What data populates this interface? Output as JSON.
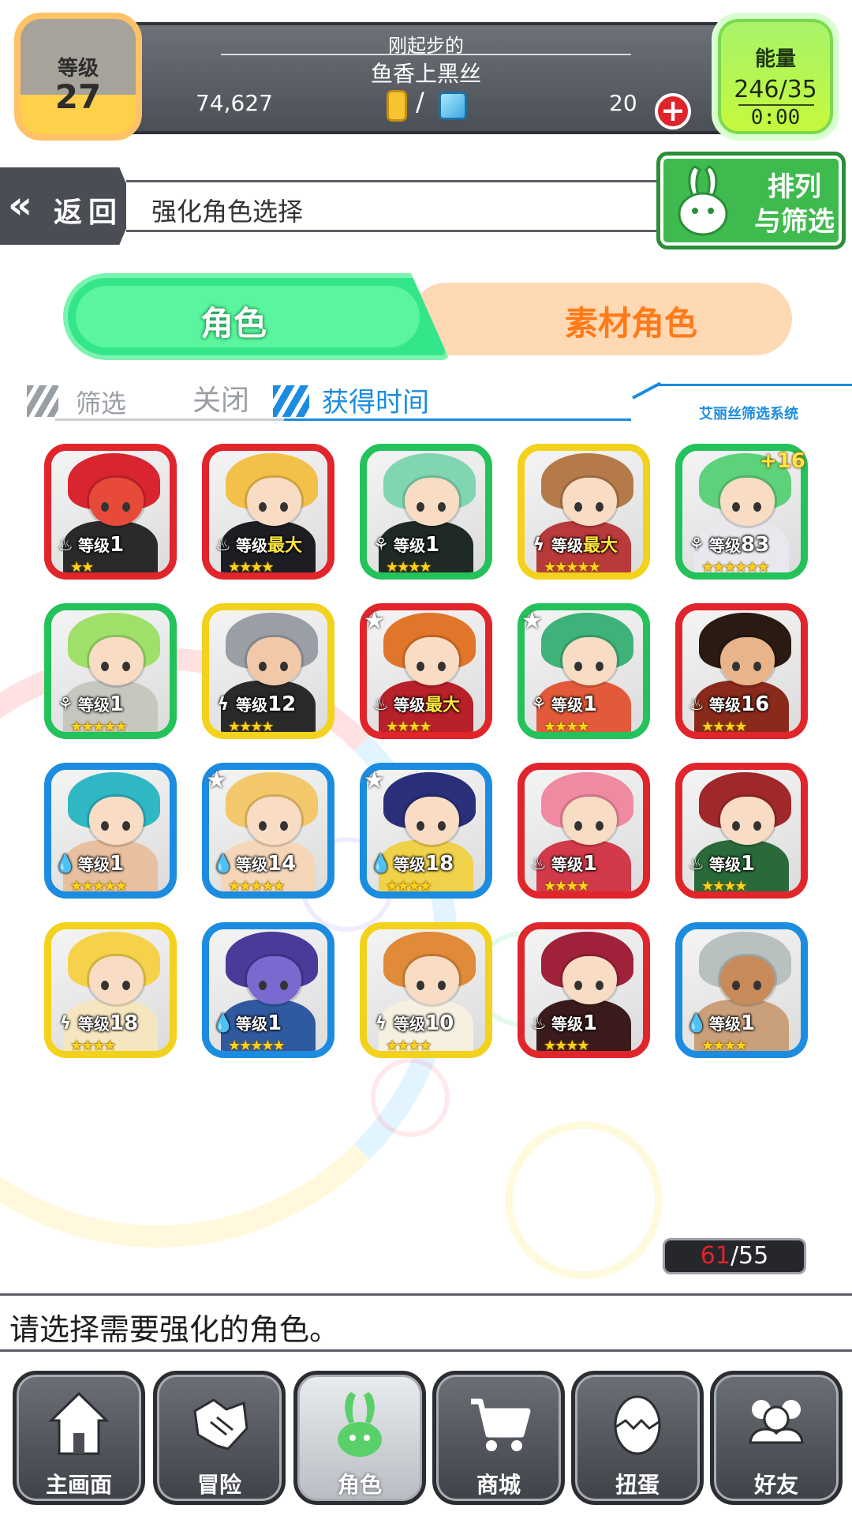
{
  "status": {
    "level_label": "等级",
    "level_value": "27",
    "player_title": "刚起步的",
    "player_name": "鱼香上黑丝",
    "gold": "74,627",
    "separator": "/",
    "gems": "20",
    "energy_label": "能量",
    "energy_value": "246/35",
    "energy_timer": "0:00"
  },
  "header": {
    "back_label": "返回",
    "page_title": "强化角色选择",
    "sort_label_line1": "排列",
    "sort_label_line2": "与筛选"
  },
  "tabs": {
    "character": "角色",
    "material": "素材角色"
  },
  "filter": {
    "filter_label": "筛选",
    "filter_value": "关闭",
    "sort_value": "获得时间",
    "system_label": "艾丽丝筛选系统"
  },
  "level_prefix": "等级",
  "characters": [
    {
      "level": "1",
      "element": "fire",
      "frame": "#e0252b",
      "stars": "★★",
      "hair": "#d8252f",
      "body": "#2a2a2a",
      "skin": "#e84a3a"
    },
    {
      "level": "最大",
      "element": "fire",
      "frame": "#e0252b",
      "stars": "★★★★",
      "hair": "#f3c04a",
      "body": "#1d1d24",
      "skin": "#f9dcc4"
    },
    {
      "level": "1",
      "element": "wood",
      "frame": "#24c25a",
      "stars": "★★★★",
      "hair": "#7fd6b0",
      "body": "#1f2a24",
      "skin": "#f9dcc4"
    },
    {
      "level": "最大",
      "element": "thunder",
      "frame": "#f2d21c",
      "stars": "★★★★★",
      "hair": "#b57a4a",
      "body": "#b83a3a",
      "skin": "#f9dcc4"
    },
    {
      "level": "83",
      "element": "wood",
      "frame": "#24c25a",
      "stars": "★★★★★★",
      "hair": "#5ed27a",
      "body": "#e8e8ee",
      "skin": "#f9dcc4",
      "plus": "+16"
    },
    {
      "level": "1",
      "element": "wood",
      "frame": "#24c25a",
      "stars": "★★★★★",
      "hair": "#9fe06a",
      "body": "#c7c7c0",
      "skin": "#f9dcc4"
    },
    {
      "level": "12",
      "element": "thunder",
      "frame": "#f2d21c",
      "stars": "★★★★",
      "hair": "#9a9ea5",
      "body": "#2a2a2a",
      "skin": "#f1c9a8"
    },
    {
      "level": "最大",
      "element": "fire",
      "frame": "#e0252b",
      "stars": "★★★★",
      "hair": "#e0762a",
      "body": "#b8202a",
      "skin": "#f9dcc4",
      "star": true
    },
    {
      "level": "1",
      "element": "wood",
      "frame": "#24c25a",
      "stars": "★★★★",
      "hair": "#3fb27a",
      "body": "#e25a3a",
      "skin": "#f9dcc4",
      "star": true
    },
    {
      "level": "16",
      "element": "fire",
      "frame": "#e0252b",
      "stars": "★★★★",
      "hair": "#2a1a12",
      "body": "#8a2a1a",
      "skin": "#e9b48a"
    },
    {
      "level": "1",
      "element": "water",
      "frame": "#1b8ce0",
      "stars": "★★★★★",
      "hair": "#2fb8c4",
      "body": "#e8c0a0",
      "skin": "#f9dcc4"
    },
    {
      "level": "14",
      "element": "water",
      "frame": "#1b8ce0",
      "stars": "★★★★★",
      "hair": "#f3c86a",
      "body": "#f5d6b8",
      "skin": "#f9dcc4",
      "star": true
    },
    {
      "level": "18",
      "element": "water",
      "frame": "#1b8ce0",
      "stars": "★★★★",
      "hair": "#2a2f7a",
      "body": "#f0d24a",
      "skin": "#f9dcc4",
      "star": true
    },
    {
      "level": "1",
      "element": "fire",
      "frame": "#e0252b",
      "stars": "★★★★",
      "hair": "#f08aa0",
      "body": "#d23a4a",
      "skin": "#f9dcc4"
    },
    {
      "level": "1",
      "element": "fire",
      "frame": "#e0252b",
      "stars": "★★★★",
      "hair": "#a0282a",
      "body": "#2a6a3a",
      "skin": "#f9dcc4"
    },
    {
      "level": "18",
      "element": "thunder",
      "frame": "#f2d21c",
      "stars": "★★★★",
      "hair": "#f5d24a",
      "body": "#f5e6c0",
      "skin": "#f9dcc4"
    },
    {
      "level": "1",
      "element": "water",
      "frame": "#1b8ce0",
      "stars": "★★★★★",
      "hair": "#4a3a9a",
      "body": "#2f5aa0",
      "skin": "#7a6ad0"
    },
    {
      "level": "10",
      "element": "thunder",
      "frame": "#f2d21c",
      "stars": "★★★★",
      "hair": "#e08a3a",
      "body": "#f5f0e0",
      "skin": "#f9dcc4"
    },
    {
      "level": "1",
      "element": "fire",
      "frame": "#e0252b",
      "stars": "★★★★",
      "hair": "#a0223a",
      "body": "#3a1a1a",
      "skin": "#f9dcc4"
    },
    {
      "level": "1",
      "element": "water",
      "frame": "#1b8ce0",
      "stars": "★★★★",
      "hair": "#b8c0c0",
      "body": "#c9a07a",
      "skin": "#c98a5a"
    }
  ],
  "element_glyphs": {
    "fire": "♨",
    "wood": "⚘",
    "thunder": "ϟ",
    "water": "💧"
  },
  "count": {
    "current": "61",
    "max": "/55"
  },
  "message": "请选择需要强化的角色。",
  "nav": {
    "home": "主画面",
    "adventure": "冒险",
    "character": "角色",
    "shop": "商城",
    "gacha": "扭蛋",
    "friends": "好友"
  }
}
